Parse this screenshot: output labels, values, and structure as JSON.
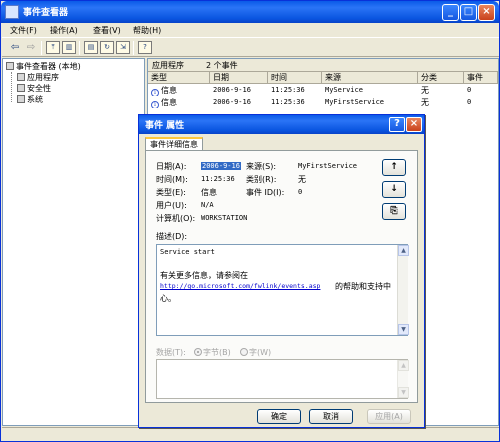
{
  "window": {
    "title": "事件查看器"
  },
  "titlebar_buttons": {
    "minimize": "_",
    "maximize": "□",
    "close": "×"
  },
  "menu": [
    "文件(F)",
    "操作(A)",
    "查看(V)",
    "帮助(H)"
  ],
  "tree": {
    "root": "事件查看器 (本地)",
    "items": [
      "应用程序",
      "安全性",
      "系统"
    ]
  },
  "list_header": {
    "name": "应用程序",
    "count": "2 个事件"
  },
  "columns": [
    "类型",
    "日期",
    "时间",
    "来源",
    "分类",
    "事件"
  ],
  "rows": [
    {
      "type": "信息",
      "date": "2006-9-16",
      "time": "11:25:36",
      "source": "MyService",
      "category": "无",
      "event": "0"
    },
    {
      "type": "信息",
      "date": "2006-9-16",
      "time": "11:25:36",
      "source": "MyFirstService",
      "category": "无",
      "event": "0"
    }
  ],
  "dialog": {
    "title": "事件 属性",
    "help_btn": "?",
    "close_btn": "×",
    "tab": "事件详细信息",
    "date_label": "日期(A):",
    "date_value": "2006-9-16",
    "source_label": "来源(S):",
    "source_value": "MyFirstService",
    "time_label": "时间(M):",
    "time_value": "11:25:36",
    "category_label": "类别(R):",
    "category_value": "无",
    "type_label": "类型(E):",
    "type_value": "信息",
    "event_id_label": "事件 ID(I):",
    "event_id_value": "0",
    "user_label": "用户(U):",
    "user_value": "N/A",
    "computer_label": "计算机(O):",
    "computer_value": "WORKSTATION",
    "desc_label": "描述(D):",
    "desc_line1": "Service start",
    "desc_line2": "有关更多信息，请参阅在",
    "desc_link": "http://go.microsoft.com/fwlink/events.asp",
    "desc_line3": "的帮助和支持中",
    "desc_line4": "心。",
    "data_label": "数据(T):",
    "radio_bytes": "字节(B)",
    "radio_words": "字(W)",
    "btn_ok": "确定",
    "btn_cancel": "取消",
    "btn_apply": "应用(A)",
    "up_arrow": "↑",
    "down_arrow": "↓",
    "copy_icon": "⎘"
  }
}
